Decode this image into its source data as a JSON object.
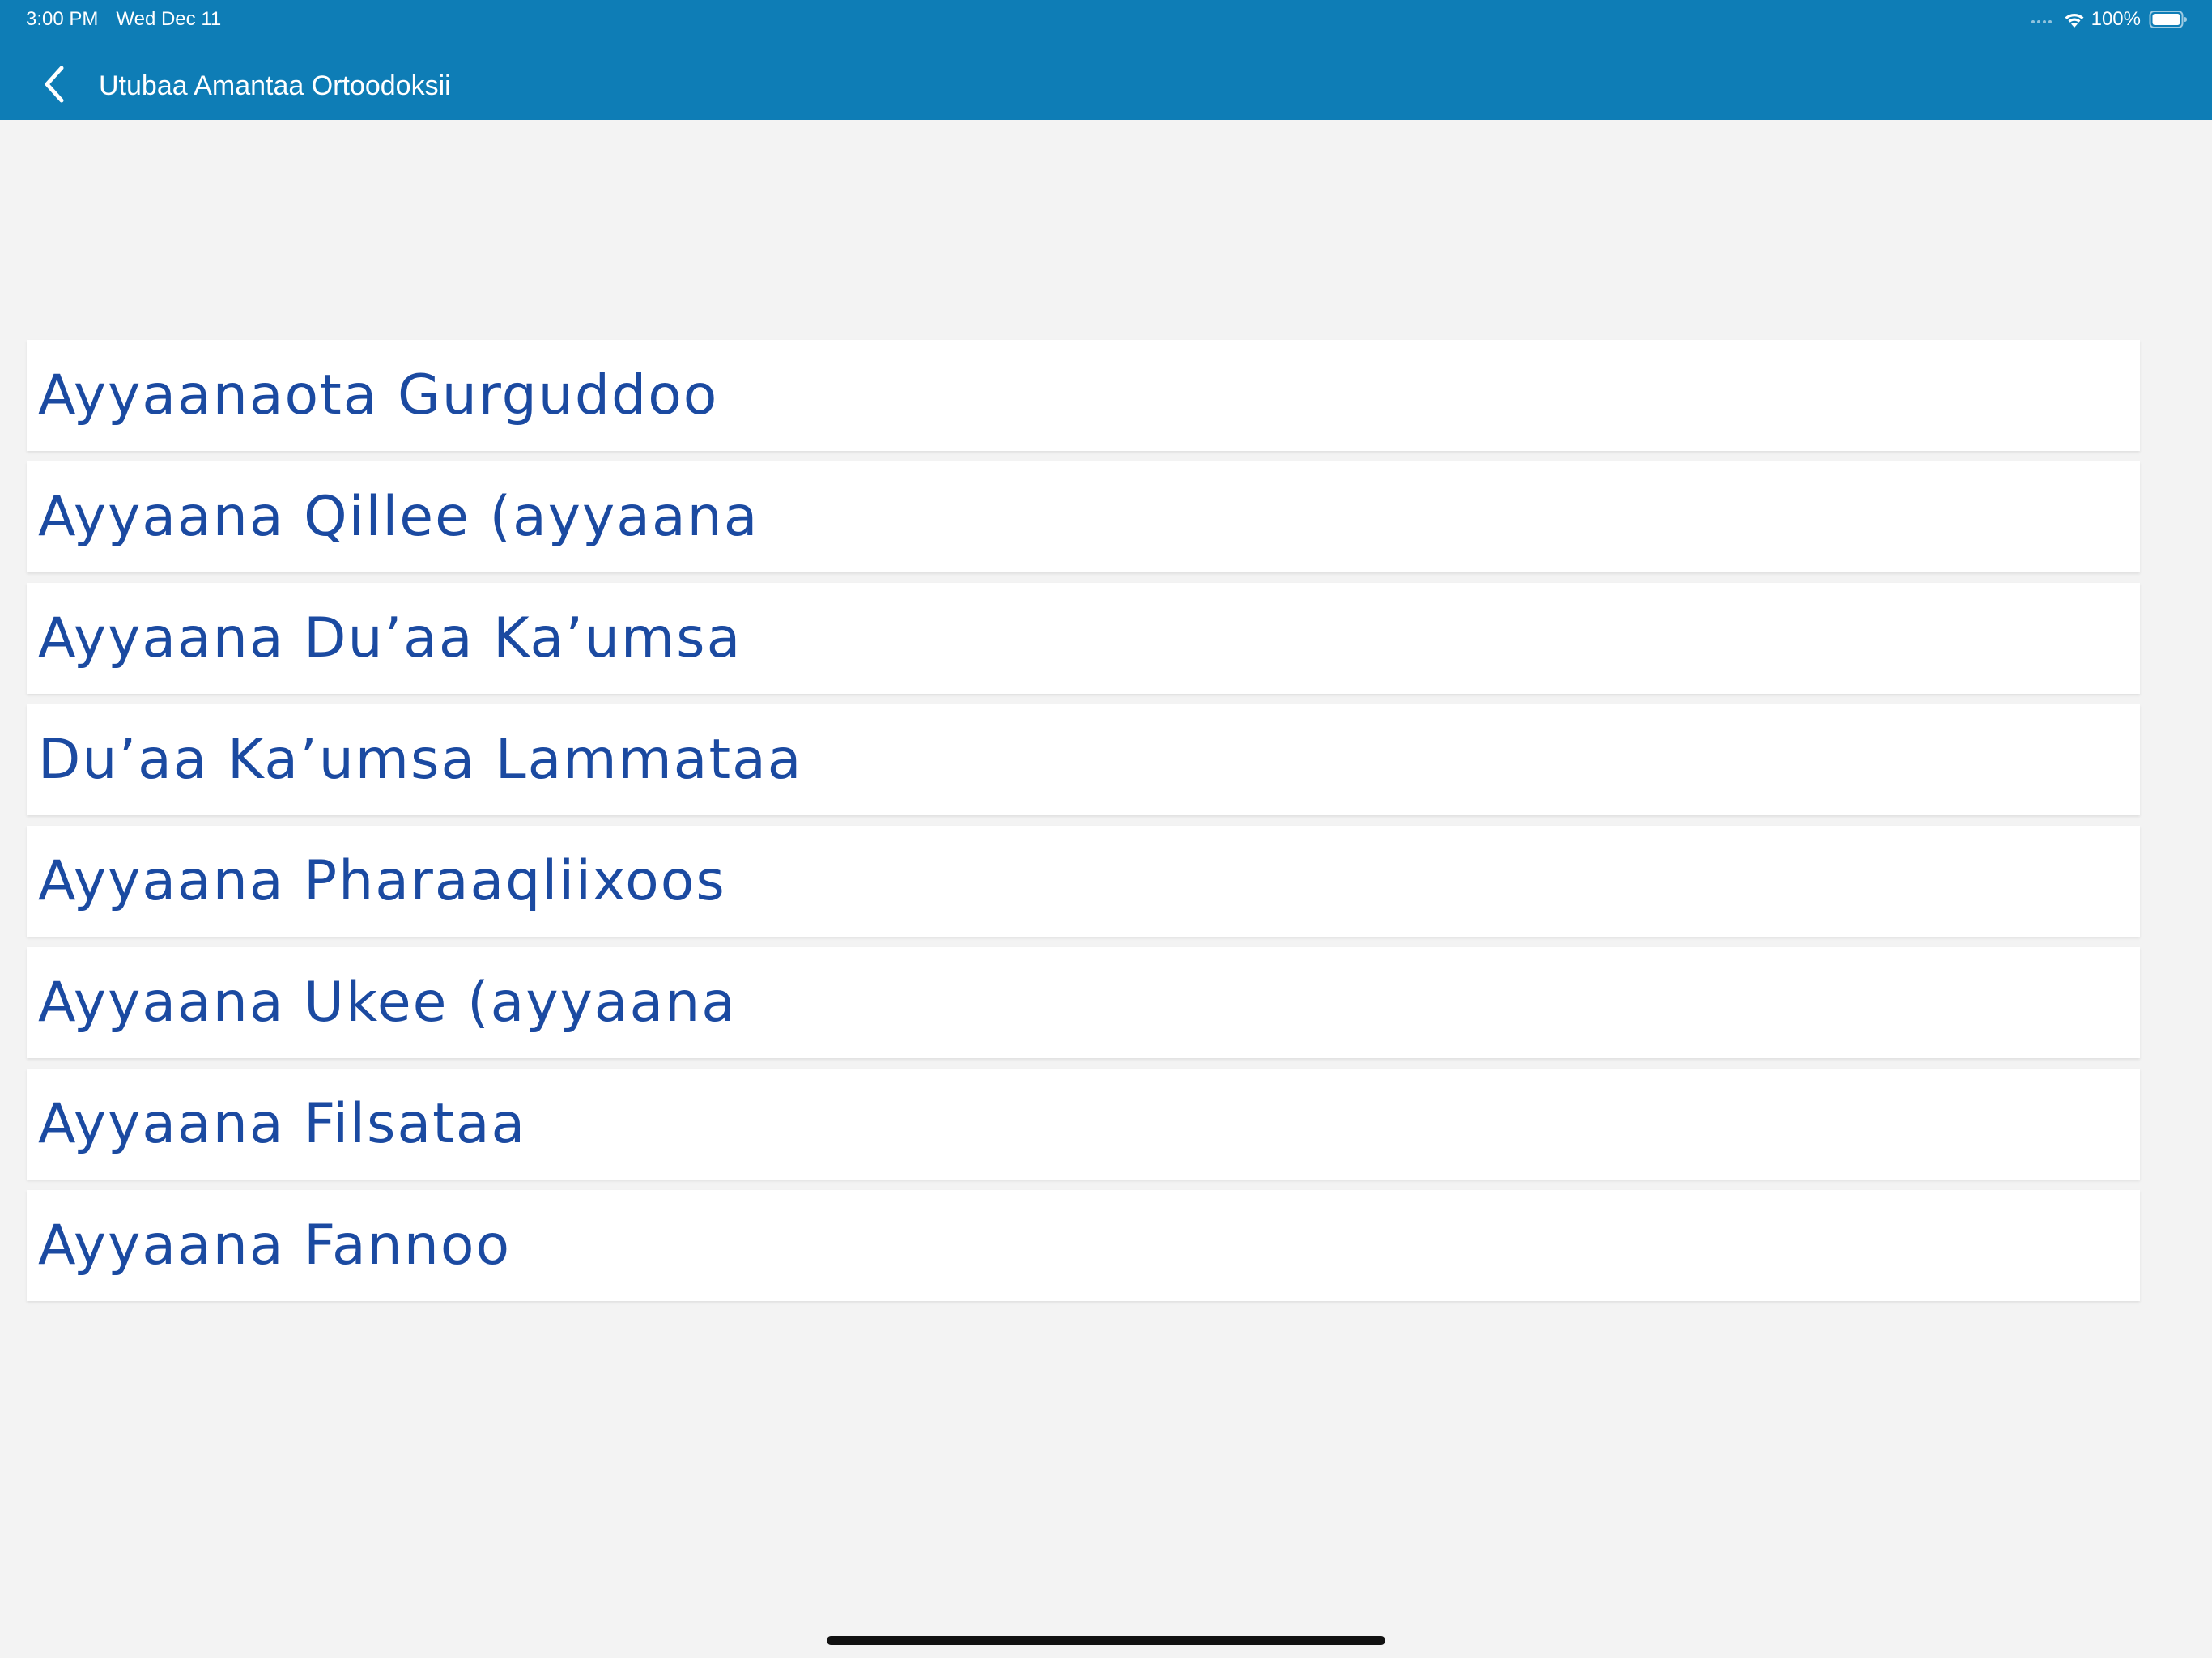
{
  "status_bar": {
    "time": "3:00 PM",
    "date": "Wed Dec 11",
    "battery": "100%",
    "icons": [
      "cellular-icon",
      "wifi-icon",
      "battery-icon"
    ]
  },
  "nav": {
    "back_icon": "chevron-left-icon",
    "title": "Utubaa Amantaa Ortoodoksii"
  },
  "list": {
    "items": [
      "Ayyaanaota Gurguddoo",
      "Ayyaana Qillee (ayyaana",
      "Ayyaana Du’aa Ka’umsa",
      "Du’aa Ka’umsa Lammataa",
      "Ayyaana Pharaaqliixoos",
      "Ayyaana Ukee (ayyaana",
      "Ayyaana Filsataa",
      "Ayyaana Fannoo"
    ]
  },
  "colors": {
    "header_bg": "#0e7db6",
    "page_bg": "#f3f3f3",
    "item_text": "#1b4aa1",
    "item_bg": "#ffffff"
  }
}
